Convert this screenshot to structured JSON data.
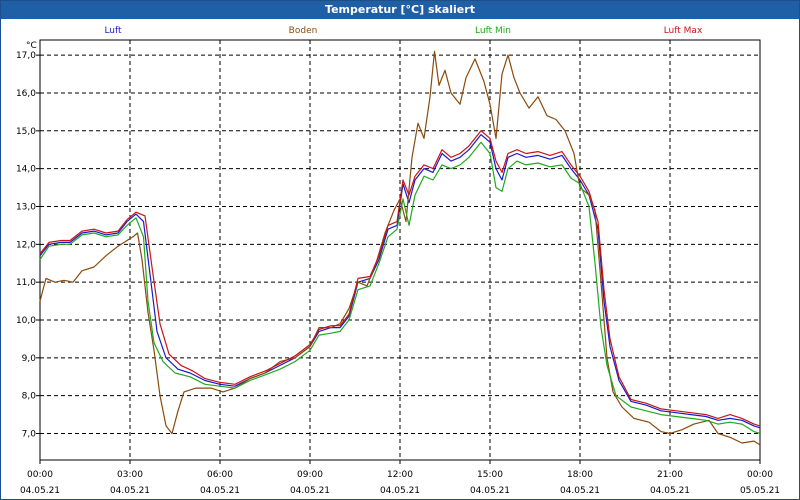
{
  "window": {
    "title": "Temperatur [°C] skaliert"
  },
  "chart_data": {
    "type": "line",
    "ylabel": "°C",
    "ylim": [
      6.3,
      17.4
    ],
    "yticks": [
      7.0,
      8.0,
      9.0,
      10.0,
      11.0,
      12.0,
      13.0,
      14.0,
      15.0,
      16.0,
      17.0
    ],
    "ytick_labels": [
      "7,0",
      "8,0",
      "9,0",
      "10,0",
      "11,0",
      "12,0",
      "13,0",
      "14,0",
      "15,0",
      "16,0",
      "17,0"
    ],
    "xlim": [
      0,
      24
    ],
    "xticks": [
      0,
      3,
      6,
      9,
      12,
      15,
      18,
      21,
      24
    ],
    "xtick_labels": [
      {
        "time": "00:00",
        "date": "04.05.21"
      },
      {
        "time": "03:00",
        "date": "04.05.21"
      },
      {
        "time": "06:00",
        "date": "04.05.21"
      },
      {
        "time": "09:00",
        "date": "04.05.21"
      },
      {
        "time": "12:00",
        "date": "04.05.21"
      },
      {
        "time": "15:00",
        "date": "04.05.21"
      },
      {
        "time": "18:00",
        "date": "04.05.21"
      },
      {
        "time": "21:00",
        "date": "04.05.21"
      },
      {
        "time": "00:00",
        "date": "05.05.21"
      }
    ],
    "grid": true,
    "legend_position": "top",
    "series": [
      {
        "name": "Luft",
        "color": "#1a1acc",
        "points": [
          [
            0,
            11.7
          ],
          [
            0.3,
            12.0
          ],
          [
            0.7,
            12.05
          ],
          [
            1.0,
            12.05
          ],
          [
            1.4,
            12.3
          ],
          [
            1.8,
            12.35
          ],
          [
            2.2,
            12.25
          ],
          [
            2.6,
            12.3
          ],
          [
            2.9,
            12.6
          ],
          [
            3.2,
            12.8
          ],
          [
            3.45,
            12.6
          ],
          [
            3.7,
            11.0
          ],
          [
            3.9,
            9.7
          ],
          [
            4.2,
            9.0
          ],
          [
            4.6,
            8.7
          ],
          [
            5.0,
            8.6
          ],
          [
            5.5,
            8.4
          ],
          [
            6.0,
            8.3
          ],
          [
            6.5,
            8.25
          ],
          [
            7.0,
            8.45
          ],
          [
            7.5,
            8.6
          ],
          [
            8.0,
            8.8
          ],
          [
            8.5,
            9.0
          ],
          [
            9.0,
            9.3
          ],
          [
            9.3,
            9.7
          ],
          [
            9.7,
            9.8
          ],
          [
            10.0,
            9.8
          ],
          [
            10.3,
            10.1
          ],
          [
            10.6,
            11.0
          ],
          [
            11.0,
            11.1
          ],
          [
            11.3,
            11.6
          ],
          [
            11.6,
            12.4
          ],
          [
            11.9,
            12.5
          ],
          [
            12.1,
            13.6
          ],
          [
            12.3,
            13.1
          ],
          [
            12.5,
            13.7
          ],
          [
            12.8,
            14.0
          ],
          [
            13.1,
            13.9
          ],
          [
            13.4,
            14.4
          ],
          [
            13.7,
            14.2
          ],
          [
            14.0,
            14.3
          ],
          [
            14.3,
            14.5
          ],
          [
            14.7,
            14.9
          ],
          [
            15.0,
            14.7
          ],
          [
            15.2,
            14.0
          ],
          [
            15.4,
            13.7
          ],
          [
            15.6,
            14.3
          ],
          [
            15.9,
            14.4
          ],
          [
            16.2,
            14.3
          ],
          [
            16.6,
            14.35
          ],
          [
            17.0,
            14.25
          ],
          [
            17.4,
            14.35
          ],
          [
            17.7,
            14.0
          ],
          [
            18.0,
            13.7
          ],
          [
            18.3,
            13.3
          ],
          [
            18.6,
            12.4
          ],
          [
            18.8,
            10.5
          ],
          [
            19.0,
            9.3
          ],
          [
            19.3,
            8.4
          ],
          [
            19.7,
            7.85
          ],
          [
            20.2,
            7.75
          ],
          [
            20.7,
            7.6
          ],
          [
            21.2,
            7.55
          ],
          [
            21.7,
            7.5
          ],
          [
            22.2,
            7.45
          ],
          [
            22.6,
            7.35
          ],
          [
            23.0,
            7.4
          ],
          [
            23.4,
            7.35
          ],
          [
            23.8,
            7.2
          ],
          [
            24.0,
            7.15
          ]
        ]
      },
      {
        "name": "Boden",
        "color": "#8b4a0c",
        "points": [
          [
            0,
            10.5
          ],
          [
            0.2,
            11.1
          ],
          [
            0.5,
            11.0
          ],
          [
            0.8,
            11.05
          ],
          [
            1.1,
            11.0
          ],
          [
            1.4,
            11.3
          ],
          [
            1.8,
            11.4
          ],
          [
            2.2,
            11.7
          ],
          [
            2.6,
            11.95
          ],
          [
            2.9,
            12.1
          ],
          [
            3.1,
            12.2
          ],
          [
            3.25,
            12.3
          ],
          [
            3.4,
            11.6
          ],
          [
            3.6,
            10.2
          ],
          [
            3.8,
            9.2
          ],
          [
            4.0,
            8.0
          ],
          [
            4.2,
            7.2
          ],
          [
            4.4,
            7.0
          ],
          [
            4.6,
            7.6
          ],
          [
            4.8,
            8.1
          ],
          [
            5.2,
            8.2
          ],
          [
            5.7,
            8.2
          ],
          [
            6.1,
            8.1
          ],
          [
            6.5,
            8.2
          ],
          [
            7.0,
            8.45
          ],
          [
            7.5,
            8.6
          ],
          [
            8.0,
            8.9
          ],
          [
            8.5,
            9.0
          ],
          [
            9.0,
            9.3
          ],
          [
            9.3,
            9.8
          ],
          [
            9.7,
            9.8
          ],
          [
            10.0,
            9.9
          ],
          [
            10.3,
            10.3
          ],
          [
            10.6,
            11.0
          ],
          [
            10.9,
            10.9
          ],
          [
            11.2,
            11.5
          ],
          [
            11.5,
            12.3
          ],
          [
            11.8,
            12.9
          ],
          [
            12.0,
            13.2
          ],
          [
            12.2,
            12.6
          ],
          [
            12.4,
            14.3
          ],
          [
            12.6,
            15.2
          ],
          [
            12.8,
            14.8
          ],
          [
            13.0,
            15.9
          ],
          [
            13.15,
            17.1
          ],
          [
            13.3,
            16.2
          ],
          [
            13.5,
            16.6
          ],
          [
            13.7,
            16.0
          ],
          [
            14.0,
            15.7
          ],
          [
            14.2,
            16.4
          ],
          [
            14.5,
            16.9
          ],
          [
            14.8,
            16.3
          ],
          [
            15.0,
            15.7
          ],
          [
            15.2,
            14.8
          ],
          [
            15.4,
            16.5
          ],
          [
            15.6,
            17.0
          ],
          [
            15.8,
            16.4
          ],
          [
            16.0,
            16.0
          ],
          [
            16.3,
            15.6
          ],
          [
            16.6,
            15.9
          ],
          [
            16.9,
            15.4
          ],
          [
            17.2,
            15.3
          ],
          [
            17.5,
            15.0
          ],
          [
            17.8,
            14.4
          ],
          [
            18.0,
            13.5
          ],
          [
            18.3,
            13.3
          ],
          [
            18.5,
            12.9
          ],
          [
            18.7,
            11.0
          ],
          [
            18.9,
            9.0
          ],
          [
            19.1,
            8.1
          ],
          [
            19.4,
            7.7
          ],
          [
            19.8,
            7.4
          ],
          [
            20.3,
            7.3
          ],
          [
            20.7,
            7.05
          ],
          [
            21.0,
            7.0
          ],
          [
            21.4,
            7.1
          ],
          [
            21.8,
            7.25
          ],
          [
            22.3,
            7.35
          ],
          [
            22.6,
            7.0
          ],
          [
            23.0,
            6.9
          ],
          [
            23.4,
            6.75
          ],
          [
            23.8,
            6.8
          ],
          [
            24.0,
            6.7
          ]
        ]
      },
      {
        "name": "Luft Min",
        "color": "#1faa1f",
        "points": [
          [
            0,
            11.6
          ],
          [
            0.3,
            11.95
          ],
          [
            0.7,
            12.0
          ],
          [
            1.0,
            12.0
          ],
          [
            1.4,
            12.25
          ],
          [
            1.8,
            12.3
          ],
          [
            2.2,
            12.2
          ],
          [
            2.6,
            12.25
          ],
          [
            2.9,
            12.5
          ],
          [
            3.2,
            12.7
          ],
          [
            3.45,
            12.2
          ],
          [
            3.6,
            10.5
          ],
          [
            3.8,
            9.4
          ],
          [
            4.1,
            8.9
          ],
          [
            4.5,
            8.6
          ],
          [
            5.0,
            8.5
          ],
          [
            5.5,
            8.3
          ],
          [
            6.0,
            8.25
          ],
          [
            6.5,
            8.2
          ],
          [
            7.0,
            8.4
          ],
          [
            7.5,
            8.55
          ],
          [
            8.0,
            8.7
          ],
          [
            8.5,
            8.9
          ],
          [
            9.0,
            9.2
          ],
          [
            9.3,
            9.6
          ],
          [
            9.7,
            9.65
          ],
          [
            10.0,
            9.7
          ],
          [
            10.3,
            10.0
          ],
          [
            10.6,
            10.8
          ],
          [
            11.0,
            10.9
          ],
          [
            11.3,
            11.5
          ],
          [
            11.6,
            12.2
          ],
          [
            11.9,
            12.4
          ],
          [
            12.1,
            13.2
          ],
          [
            12.3,
            12.5
          ],
          [
            12.5,
            13.3
          ],
          [
            12.8,
            13.8
          ],
          [
            13.1,
            13.7
          ],
          [
            13.4,
            14.1
          ],
          [
            13.7,
            14.0
          ],
          [
            14.0,
            14.1
          ],
          [
            14.3,
            14.3
          ],
          [
            14.7,
            14.7
          ],
          [
            15.0,
            14.4
          ],
          [
            15.2,
            13.5
          ],
          [
            15.4,
            13.4
          ],
          [
            15.6,
            14.0
          ],
          [
            15.9,
            14.2
          ],
          [
            16.2,
            14.1
          ],
          [
            16.6,
            14.15
          ],
          [
            17.0,
            14.05
          ],
          [
            17.4,
            14.1
          ],
          [
            17.7,
            13.75
          ],
          [
            18.0,
            13.6
          ],
          [
            18.3,
            13.0
          ],
          [
            18.5,
            11.5
          ],
          [
            18.7,
            9.8
          ],
          [
            18.9,
            8.8
          ],
          [
            19.2,
            8.0
          ],
          [
            19.7,
            7.7
          ],
          [
            20.2,
            7.6
          ],
          [
            20.7,
            7.5
          ],
          [
            21.2,
            7.45
          ],
          [
            21.7,
            7.4
          ],
          [
            22.2,
            7.35
          ],
          [
            22.6,
            7.25
          ],
          [
            23.0,
            7.3
          ],
          [
            23.4,
            7.25
          ],
          [
            23.8,
            7.05
          ],
          [
            24.0,
            7.0
          ]
        ]
      },
      {
        "name": "Luft Max",
        "color": "#c81414",
        "points": [
          [
            0,
            11.75
          ],
          [
            0.3,
            12.05
          ],
          [
            0.7,
            12.1
          ],
          [
            1.0,
            12.1
          ],
          [
            1.4,
            12.35
          ],
          [
            1.8,
            12.4
          ],
          [
            2.2,
            12.3
          ],
          [
            2.6,
            12.35
          ],
          [
            2.9,
            12.65
          ],
          [
            3.2,
            12.85
          ],
          [
            3.5,
            12.75
          ],
          [
            3.75,
            11.3
          ],
          [
            4.0,
            9.9
          ],
          [
            4.3,
            9.1
          ],
          [
            4.7,
            8.8
          ],
          [
            5.1,
            8.65
          ],
          [
            5.5,
            8.45
          ],
          [
            6.0,
            8.35
          ],
          [
            6.5,
            8.3
          ],
          [
            7.0,
            8.5
          ],
          [
            7.5,
            8.65
          ],
          [
            8.0,
            8.85
          ],
          [
            8.5,
            9.05
          ],
          [
            9.0,
            9.35
          ],
          [
            9.3,
            9.75
          ],
          [
            9.7,
            9.85
          ],
          [
            10.0,
            9.85
          ],
          [
            10.3,
            10.15
          ],
          [
            10.6,
            11.1
          ],
          [
            11.0,
            11.15
          ],
          [
            11.3,
            11.7
          ],
          [
            11.6,
            12.5
          ],
          [
            11.9,
            12.6
          ],
          [
            12.1,
            13.7
          ],
          [
            12.3,
            13.3
          ],
          [
            12.5,
            13.8
          ],
          [
            12.8,
            14.1
          ],
          [
            13.1,
            14.0
          ],
          [
            13.4,
            14.5
          ],
          [
            13.7,
            14.3
          ],
          [
            14.0,
            14.4
          ],
          [
            14.3,
            14.6
          ],
          [
            14.7,
            15.0
          ],
          [
            15.0,
            14.8
          ],
          [
            15.2,
            14.2
          ],
          [
            15.4,
            13.9
          ],
          [
            15.6,
            14.4
          ],
          [
            15.9,
            14.5
          ],
          [
            16.2,
            14.4
          ],
          [
            16.6,
            14.45
          ],
          [
            17.0,
            14.35
          ],
          [
            17.4,
            14.45
          ],
          [
            17.7,
            14.1
          ],
          [
            18.0,
            13.8
          ],
          [
            18.3,
            13.4
          ],
          [
            18.6,
            12.6
          ],
          [
            18.8,
            10.8
          ],
          [
            19.0,
            9.5
          ],
          [
            19.3,
            8.5
          ],
          [
            19.7,
            7.9
          ],
          [
            20.2,
            7.8
          ],
          [
            20.7,
            7.65
          ],
          [
            21.2,
            7.6
          ],
          [
            21.7,
            7.55
          ],
          [
            22.2,
            7.5
          ],
          [
            22.6,
            7.4
          ],
          [
            23.0,
            7.5
          ],
          [
            23.4,
            7.4
          ],
          [
            23.8,
            7.25
          ],
          [
            24.0,
            7.2
          ]
        ]
      }
    ]
  }
}
